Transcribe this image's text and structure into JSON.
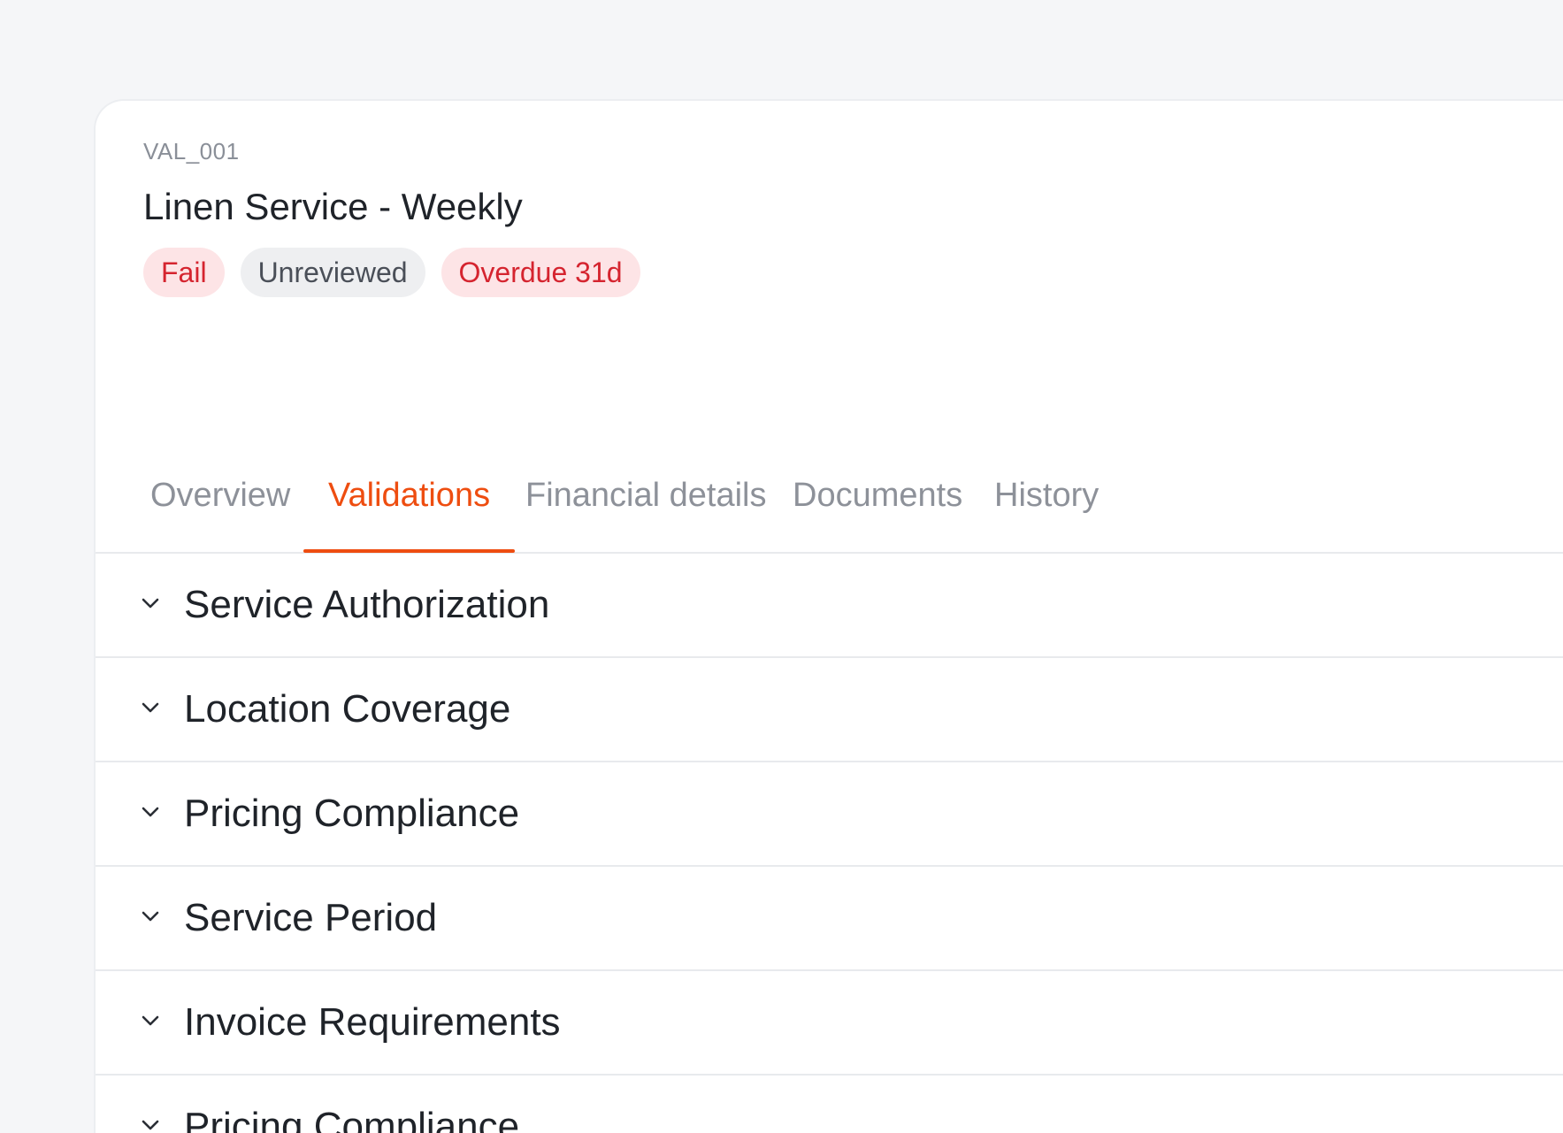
{
  "record": {
    "id": "VAL_001",
    "title": "Linen Service - Weekly",
    "badges": {
      "status": "Fail",
      "review": "Unreviewed",
      "overdue": "Overdue 31d"
    }
  },
  "tabs": [
    {
      "label": "Overview",
      "active": false
    },
    {
      "label": "Validations",
      "active": true
    },
    {
      "label": "Financial details",
      "active": false
    },
    {
      "label": "Documents",
      "active": false
    },
    {
      "label": "History",
      "active": false
    }
  ],
  "sections": [
    {
      "label": "Service Authorization",
      "icon": "chevron-down-icon"
    },
    {
      "label": "Location Coverage",
      "icon": "chevron-down-icon"
    },
    {
      "label": "Pricing Compliance",
      "icon": "chevron-down-icon"
    },
    {
      "label": "Service Period",
      "icon": "chevron-down-icon"
    },
    {
      "label": "Invoice Requirements",
      "icon": "chevron-down-icon"
    },
    {
      "label": "Pricing Compliance",
      "icon": "chevron-down-icon"
    }
  ],
  "colors": {
    "accent": "#ee4d10",
    "fail_text": "#d5242f",
    "fail_bg": "#fde4e6",
    "neutral_bg": "#eeeff1",
    "page_bg": "#f5f6f8"
  }
}
